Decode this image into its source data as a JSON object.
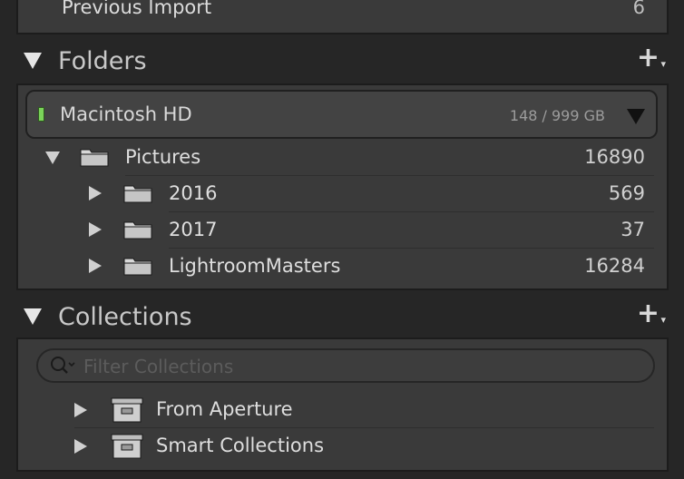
{
  "previous_import": {
    "label": "Previous Import",
    "count": "6"
  },
  "folders": {
    "title": "Folders",
    "add": "+",
    "volume": {
      "name": "Macintosh HD",
      "size": "148 / 999 GB"
    },
    "items": [
      {
        "label": "Pictures",
        "count": "16890"
      },
      {
        "label": "2016",
        "count": "569"
      },
      {
        "label": "2017",
        "count": "37"
      },
      {
        "label": "LightroomMasters",
        "count": "16284"
      }
    ]
  },
  "collections": {
    "title": "Collections",
    "add": "+",
    "filter_placeholder": "Filter Collections",
    "items": [
      {
        "label": "From Aperture"
      },
      {
        "label": "Smart Collections"
      }
    ]
  },
  "colors": {
    "led": "#7bd35a",
    "panel": "#3a3a3a",
    "background": "#262626"
  }
}
